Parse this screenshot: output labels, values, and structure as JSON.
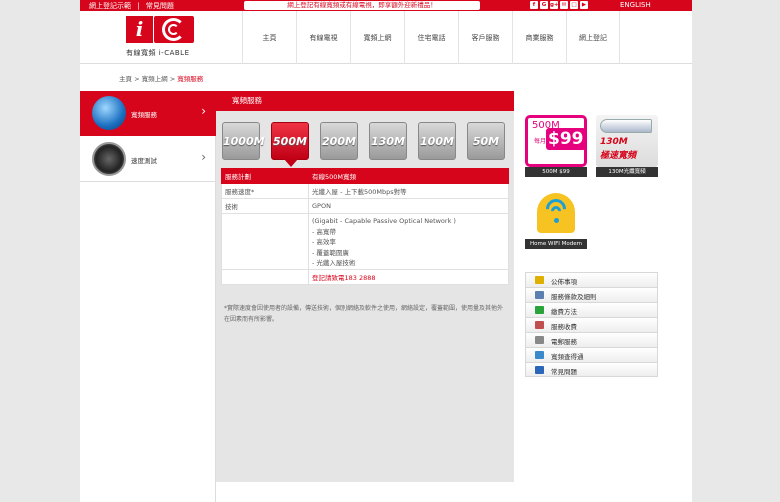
{
  "topbar": {
    "links": [
      "網上登記示範",
      "|",
      "常見問題"
    ],
    "promo": "網上登記有線寬頻或有線電視，即享額外迎新禮品！",
    "social": [
      "f",
      "G",
      "g+",
      "✉",
      "□",
      "▶"
    ],
    "lang": "ENGLISH"
  },
  "logo": {
    "mark": "i",
    "text": "有線寬頻 i-CABLE"
  },
  "nav": [
    "主頁",
    "有線電視",
    "寬頻上網",
    "住宅電話",
    "客戶服務",
    "商業服務",
    "網上登記"
  ],
  "breadcrumb": {
    "home": "主頁",
    "sep": ">",
    "section": "寬頻上網",
    "current": "寬頻服務"
  },
  "sidebar": {
    "items": [
      {
        "label": "寬頻服務",
        "arrow": "›"
      },
      {
        "label": "速度測試",
        "arrow": "›"
      }
    ]
  },
  "main": {
    "title": "寬頻服務",
    "tabs": [
      "1000M",
      "500M",
      "200M",
      "130M",
      "100M",
      "50M"
    ],
    "table": {
      "head": [
        "服務計劃",
        "有線500M寬頻"
      ],
      "rows": [
        [
          "服務速度*",
          "光纖入屋 - 上下載500Mbps對等"
        ],
        [
          "技術",
          "GPON"
        ]
      ],
      "details": [
        "(Gigabit - Capable Passive Optical Network )",
        "- 高寬帶",
        "- 高效率",
        "- 覆蓋範圍廣",
        "- 光纖入屋技術"
      ],
      "hotline": "登記請致電183 2888"
    },
    "note": "*實際速度會因使用者的設備，傳送技術，個別網絡及軟件之使用，網絡設定，覆蓋範圍，使用量及其他外在因素而有所影響。"
  },
  "promos": [
    {
      "speed": "500M",
      "monthly": "每月",
      "price": "$99",
      "caption": "500M $99"
    },
    {
      "line1": "130M",
      "line2": "極速寬頻",
      "caption": "130M光纖寬頻"
    },
    {
      "caption": "Home WIFI Modem"
    }
  ],
  "quicklinks": [
    {
      "label": "公佈事項",
      "color": "#e0b000"
    },
    {
      "label": "服務條款及細則",
      "color": "#5a7fb0"
    },
    {
      "label": "繳費方法",
      "color": "#2aa33a"
    },
    {
      "label": "服務收費",
      "color": "#c05050"
    },
    {
      "label": "電郵服務",
      "color": "#888888"
    },
    {
      "label": "寬頻查得通",
      "color": "#3a8acb"
    },
    {
      "label": "常見問題",
      "color": "#2b66b8"
    }
  ],
  "colors": {
    "brand": "#d7051b",
    "promo_pink": "#e6007e"
  }
}
